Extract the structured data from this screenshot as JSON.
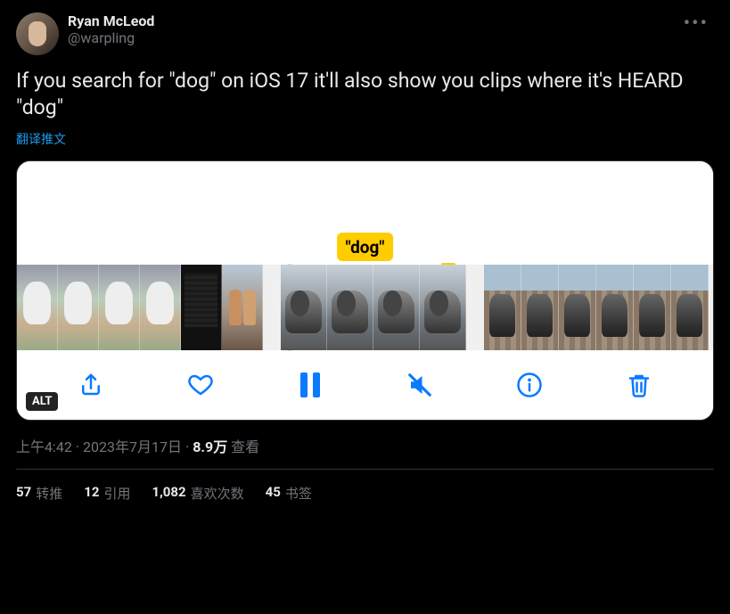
{
  "author": {
    "display_name": "Ryan McLeod",
    "handle": "@warpling"
  },
  "tweet_text": "If you search for \"dog\" on iOS 17 it'll also show you clips where it's HEARD \"dog\"",
  "translate_label": "翻译推文",
  "media": {
    "caption_label": "\"dog\"",
    "alt_badge": "ALT",
    "toolbar_icons": {
      "share": "share-icon",
      "like": "heart-icon",
      "pause": "pause-icon",
      "mute": "mute-icon",
      "info": "info-icon",
      "delete": "trash-icon"
    }
  },
  "meta": {
    "time": "上午4:42",
    "date": "2023年7月17日",
    "views_count": "8.9万",
    "views_label": "查看"
  },
  "stats": {
    "retweets_count": "57",
    "retweets_label": "转推",
    "quotes_count": "12",
    "quotes_label": "引用",
    "likes_count": "1,082",
    "likes_label": "喜欢次数",
    "bookmarks_count": "45",
    "bookmarks_label": "书签"
  }
}
